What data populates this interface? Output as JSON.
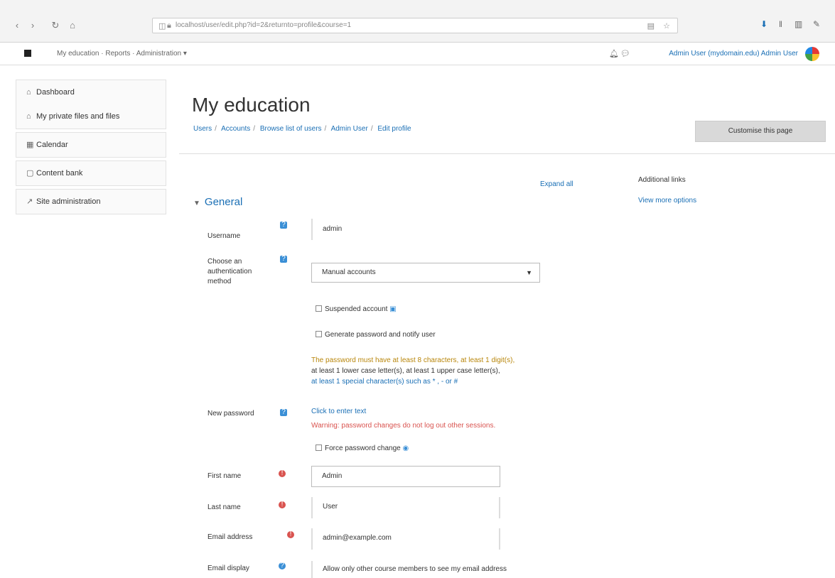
{
  "browser": {
    "url": "localhost/user/edit.php?id=2&returnto=profile&course=1"
  },
  "appbar": {
    "breadcrumb": "My education  ·  Reports  ·  Administration ▾",
    "user": "Admin User  (mydomain.edu)  Admin User"
  },
  "sidebar": {
    "groups": [
      [
        {
          "icon": "⌂",
          "label": "Dashboard"
        },
        {
          "icon": "⌂",
          "label": "My private files and files"
        }
      ],
      [
        {
          "icon": "▦",
          "label": "Calendar"
        }
      ],
      [
        {
          "icon": "▢",
          "label": "Content bank"
        }
      ],
      [
        {
          "icon": "↗",
          "label": "Site administration"
        }
      ]
    ]
  },
  "page": {
    "title": "My education",
    "breadcrumb": [
      "Users",
      "Accounts",
      "Browse list of users",
      "Admin User",
      "Edit profile"
    ],
    "customise_button": "Customise this page"
  },
  "form": {
    "expand_all": "Expand all",
    "right_panel": {
      "title": "Additional links",
      "link": "View more options"
    },
    "section": "General",
    "username": {
      "label": "Username",
      "value": "admin"
    },
    "auth": {
      "label": "Choose an authentication method",
      "value": "Manual accounts"
    },
    "suspended": "Suspended account",
    "gen_password": "Generate password and notify user",
    "note_line1": "The password must have at least 8 characters, at least 1 digit(s),",
    "note_line2": "at least 1 lower case letter(s), at least 1 upper case letter(s),",
    "note_line3": "at least 1 special character(s) such as * , - or #",
    "new_password": {
      "label": "New password",
      "link": "Click to enter text",
      "warning": "Warning: password changes do not log out other sessions."
    },
    "force_change": "Force password change",
    "firstname": {
      "label": "First name",
      "value": "Admin"
    },
    "lastname": {
      "label": "Last name",
      "value": "User"
    },
    "email": {
      "label": "Email address",
      "value": "admin@example.com"
    },
    "mail_format": {
      "label": "Email display",
      "value": "Allow only other course members to see my email address"
    }
  }
}
